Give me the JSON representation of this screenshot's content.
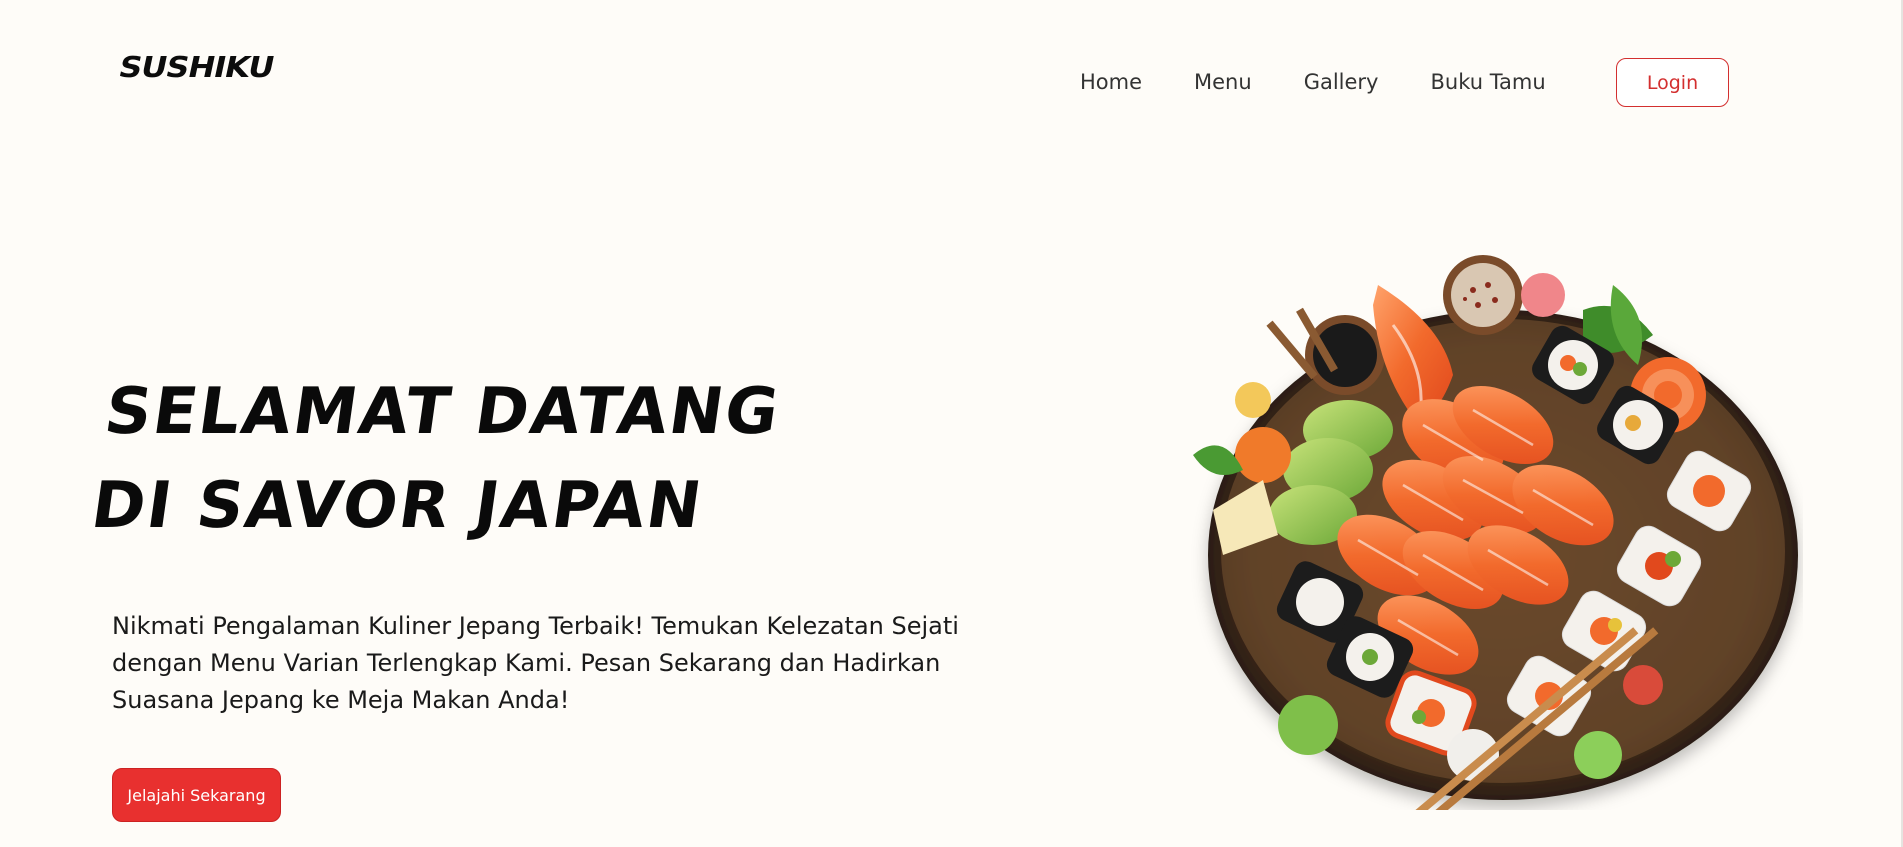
{
  "brand": {
    "logo": "SUSHIKU"
  },
  "nav": {
    "items": [
      {
        "label": "Home"
      },
      {
        "label": "Menu"
      },
      {
        "label": "Gallery"
      },
      {
        "label": "Buku Tamu"
      }
    ],
    "login_label": "Login"
  },
  "hero": {
    "title_line1": "Selamat Datang",
    "title_line2": "di Savor Japan",
    "description": "Nikmati Pengalaman Kuliner Jepang Terbaik! Temukan Kelezatan Sejati dengan Menu Varian Terlengkap Kami. Pesan Sekarang dan Hadirkan Suasana Jepang ke Meja Makan Anda!",
    "cta_label": "Jelajahi Sekarang"
  },
  "colors": {
    "accent": "#e8302f",
    "background": "#fefcf8",
    "text": "#111111"
  },
  "icons": {
    "hero_image": "sushi-platter-image"
  }
}
